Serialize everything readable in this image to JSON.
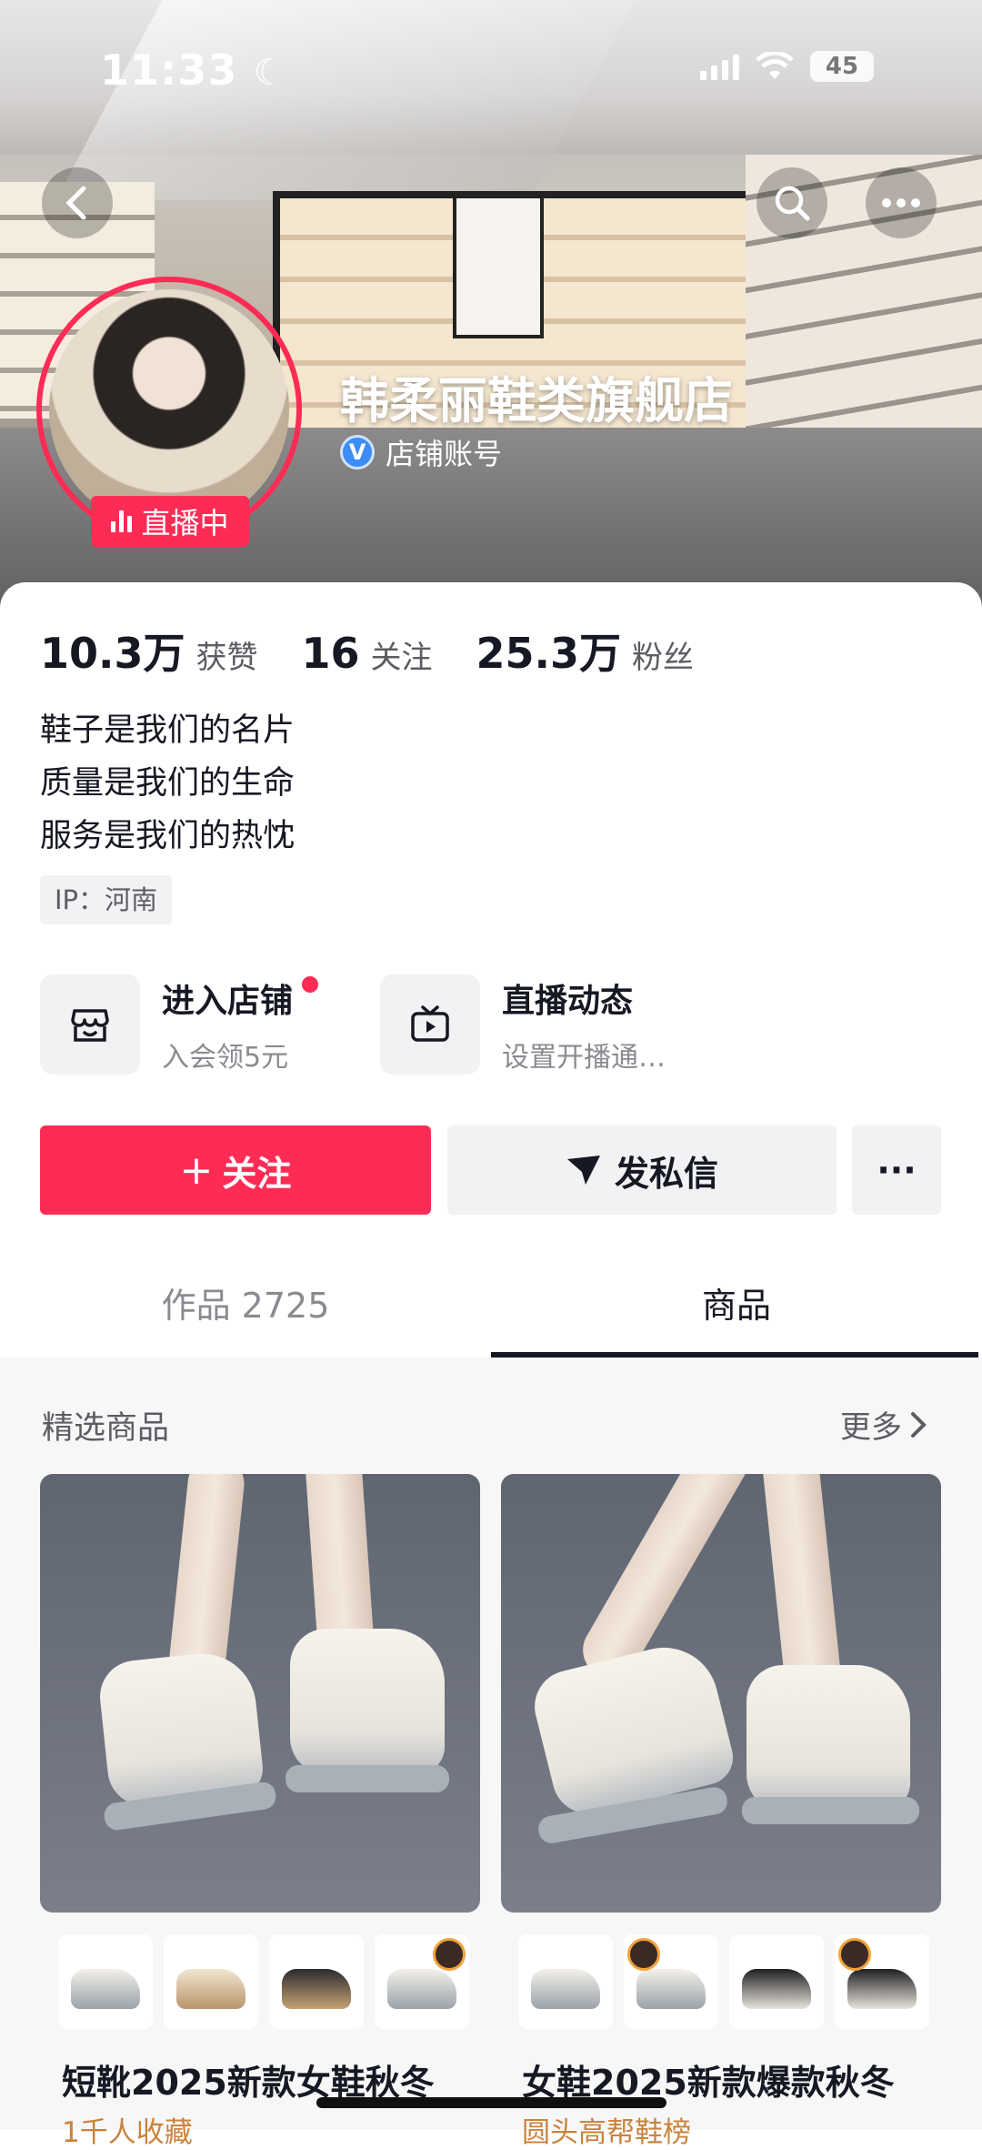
{
  "status_bar": {
    "time": "11:33",
    "battery": "45"
  },
  "profile": {
    "name": "韩柔丽鞋类旗舰店",
    "verified_label": "店铺账号",
    "live_label": "直播中"
  },
  "stats": [
    {
      "value": "10.3万",
      "label": "获赞"
    },
    {
      "value": "16",
      "label": "关注"
    },
    {
      "value": "25.3万",
      "label": "粉丝"
    }
  ],
  "bio": [
    "鞋子是我们的名片",
    "质量是我们的生命",
    "服务是我们的热忱"
  ],
  "ip": "IP：河南",
  "entries": [
    {
      "title": "进入店铺",
      "sub": "入会领5元",
      "icon": "shop-icon"
    },
    {
      "title": "直播动态",
      "sub": "设置开播通…",
      "icon": "tv-icon"
    }
  ],
  "buttons": {
    "follow": "关注",
    "message": "发私信",
    "more": "···"
  },
  "tabs": {
    "works": "作品 2725",
    "goods": "商品"
  },
  "section": {
    "title": "精选商品",
    "more": "更多"
  },
  "products": [
    {
      "title": "短靴2025新款女鞋秋冬",
      "sub": "1千人收藏"
    },
    {
      "title": "女鞋2025新款爆款秋冬",
      "sub": "圆头高帮鞋榜"
    }
  ],
  "colors": {
    "accent": "#fe2c55",
    "verify": "#3d8cf7"
  }
}
